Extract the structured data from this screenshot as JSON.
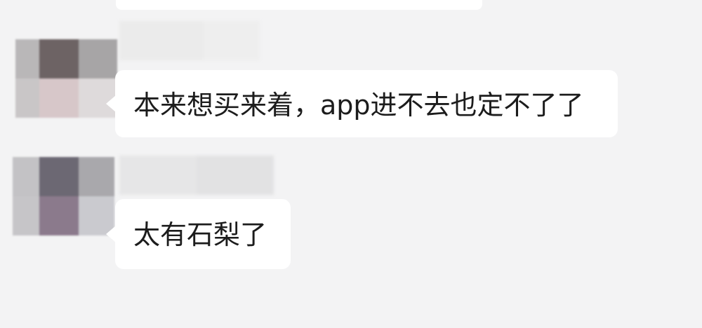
{
  "messages": [
    {
      "text": "本来想买来着，app进不去也定不了了"
    },
    {
      "text": "太有石梨了"
    }
  ]
}
